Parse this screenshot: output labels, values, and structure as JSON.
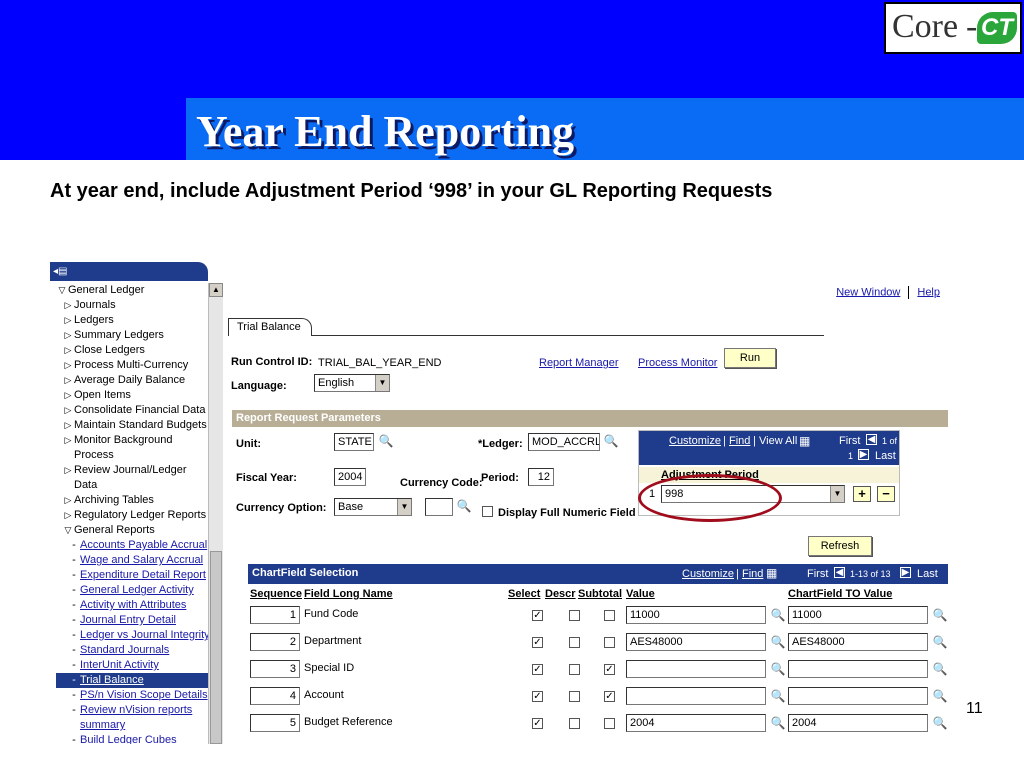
{
  "slide": {
    "title": "Year End Reporting",
    "subtitle": "At year end, include Adjustment Period ‘998’ in your GL Reporting Requests",
    "page_number": "11",
    "logo": {
      "text_core": "Core",
      "text_dash": "-",
      "text_ct": "CT"
    }
  },
  "nav": {
    "items": [
      {
        "label": "General Ledger",
        "glyph": "▽",
        "level": 1
      },
      {
        "label": "Journals",
        "glyph": "▷",
        "level": 2
      },
      {
        "label": "Ledgers",
        "glyph": "▷",
        "level": 2
      },
      {
        "label": "Summary Ledgers",
        "glyph": "▷",
        "level": 2
      },
      {
        "label": "Close Ledgers",
        "glyph": "▷",
        "level": 2
      },
      {
        "label": "Process Multi-Currency",
        "glyph": "▷",
        "level": 2
      },
      {
        "label": "Average Daily Balance",
        "glyph": "▷",
        "level": 2
      },
      {
        "label": "Open Items",
        "glyph": "▷",
        "level": 2
      },
      {
        "label": "Consolidate Financial Data",
        "glyph": "▷",
        "level": 2
      },
      {
        "label": "Maintain Standard Budgets",
        "glyph": "▷",
        "level": 2
      },
      {
        "label": "Monitor Background",
        "glyph": "▷",
        "level": 2
      },
      {
        "label": "Process",
        "glyph": "",
        "level": 2
      },
      {
        "label": "Review Journal/Ledger",
        "glyph": "▷",
        "level": 2
      },
      {
        "label": "Data",
        "glyph": "",
        "level": 2
      },
      {
        "label": "Archiving Tables",
        "glyph": "▷",
        "level": 2
      },
      {
        "label": "Regulatory Ledger Reports",
        "glyph": "▷",
        "level": 2
      },
      {
        "label": "General Reports",
        "glyph": "▽",
        "level": 2
      },
      {
        "label": "Accounts Payable Accrual",
        "glyph": "-",
        "level": 3,
        "link": true
      },
      {
        "label": "Wage and Salary Accrual",
        "glyph": "-",
        "level": 3,
        "link": true
      },
      {
        "label": "Expenditure Detail Report",
        "glyph": "-",
        "level": 3,
        "link": true
      },
      {
        "label": "General Ledger Activity",
        "glyph": "-",
        "level": 3,
        "link": true
      },
      {
        "label": "Activity with Attributes",
        "glyph": "-",
        "level": 3,
        "link": true
      },
      {
        "label": "Journal Entry Detail",
        "glyph": "-",
        "level": 3,
        "link": true
      },
      {
        "label": "Ledger vs Journal Integrity",
        "glyph": "-",
        "level": 3,
        "link": true
      },
      {
        "label": "Standard Journals",
        "glyph": "-",
        "level": 3,
        "link": true
      },
      {
        "label": "InterUnit Activity",
        "glyph": "-",
        "level": 3,
        "link": true
      },
      {
        "label": "Trial Balance",
        "glyph": "-",
        "level": 3,
        "link": true,
        "selected": true
      },
      {
        "label": "PS/n Vision Scope Details",
        "glyph": "-",
        "level": 3,
        "link": true
      },
      {
        "label": "Review nVision reports",
        "glyph": "-",
        "level": 3,
        "link": true
      },
      {
        "label": "summary",
        "glyph": "",
        "level": 3,
        "link": true
      },
      {
        "label": "Build Ledger Cubes",
        "glyph": "-",
        "level": 3,
        "link": true
      }
    ]
  },
  "toplinks": {
    "new_window": "New Window",
    "help": "Help"
  },
  "tab": {
    "label": "Trial Balance"
  },
  "form": {
    "run_control_label": "Run Control ID:",
    "run_control_value": "TRIAL_BAL_YEAR_END",
    "report_manager": "Report Manager",
    "process_monitor": "Process Monitor",
    "run_button": "Run",
    "language_label": "Language:",
    "language_value": "English",
    "section_title": "Report Request Parameters",
    "unit_label": "Unit:",
    "unit_value": "STATE",
    "ledger_label": "*Ledger:",
    "ledger_value": "MOD_ACCRL",
    "fiscal_year_label": "Fiscal Year:",
    "fiscal_year_value": "2004",
    "currency_code_label": "Currency Code:",
    "period_label": "Period:",
    "period_value": "12",
    "currency_option_label": "Currency Option:",
    "currency_option_value": "Base",
    "display_full_label": "Display Full Numeric Field",
    "refresh_button": "Refresh"
  },
  "adj_grid": {
    "customize": "Customize",
    "find": "Find",
    "view_all": "View All",
    "first": "First",
    "range_top": "1 of",
    "range_bottom": "1",
    "last": "Last",
    "col_header": "Adjustment Period",
    "row_num": "1",
    "row_value": "998",
    "plus": "+",
    "minus": "−"
  },
  "chartfield": {
    "title": "ChartField Selection",
    "customize": "Customize",
    "find": "Find",
    "first": "First",
    "range": "1-13 of 13",
    "last": "Last",
    "headers": {
      "sequence": "Sequence",
      "field": "Field Long Name",
      "select": "Select",
      "descr": "Descr",
      "subtotal": "Subtotal",
      "value": "Value",
      "to_value": "ChartField TO Value"
    },
    "rows": [
      {
        "seq": "1",
        "name": "Fund Code",
        "select": true,
        "descr": false,
        "subtotal": false,
        "value": "11000",
        "to_value": "11000"
      },
      {
        "seq": "2",
        "name": "Department",
        "select": true,
        "descr": false,
        "subtotal": false,
        "value": "AES48000",
        "to_value": "AES48000"
      },
      {
        "seq": "3",
        "name": "Special ID",
        "select": true,
        "descr": false,
        "subtotal": true,
        "value": "",
        "to_value": ""
      },
      {
        "seq": "4",
        "name": "Account",
        "select": true,
        "descr": false,
        "subtotal": true,
        "value": "",
        "to_value": ""
      },
      {
        "seq": "5",
        "name": "Budget Reference",
        "select": true,
        "descr": false,
        "subtotal": false,
        "value": "2004",
        "to_value": "2004"
      }
    ]
  }
}
